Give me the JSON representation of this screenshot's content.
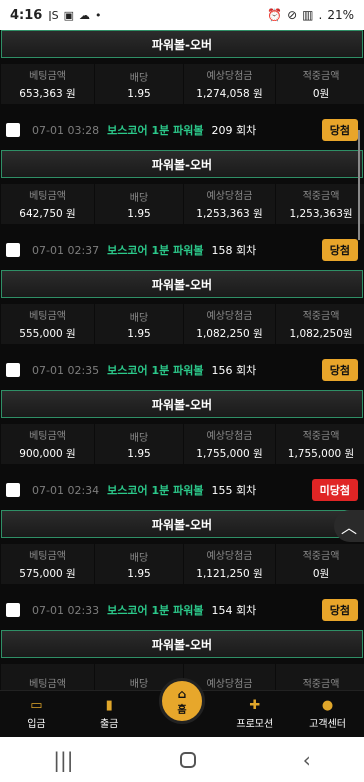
{
  "status": {
    "time": "4:16",
    "battery": "21%",
    "icons": [
      "ǀS",
      "▣",
      "☁",
      "•"
    ],
    "right_icons": [
      "⏰",
      "⊘",
      "▥",
      "."
    ]
  },
  "nav": {
    "deposit": "입금",
    "withdraw": "출금",
    "home": "홈",
    "promotion": "프로모션",
    "support": "고객센터"
  },
  "labels": {
    "bet": "베팅금액",
    "odds": "배당",
    "expected": "예상당첨금",
    "won": "적중금액"
  },
  "bets": [
    {
      "pick": "파워볼-오버",
      "amount": "653,363 원",
      "odds": "1.95",
      "expected": "1,274,058 원",
      "won": "0원"
    },
    {
      "date": "07-01 03:28",
      "game": "보스코어 1분 파워볼",
      "round": "209 회차",
      "result": "당첨",
      "pick": "파워볼-오버",
      "amount": "642,750 원",
      "odds": "1.95",
      "expected": "1,253,363 원",
      "won": "1,253,363원"
    },
    {
      "date": "07-01 02:37",
      "game": "보스코어 1분 파워볼",
      "round": "158 회차",
      "result": "당첨",
      "pick": "파워볼-오버",
      "amount": "555,000 원",
      "odds": "1.95",
      "expected": "1,082,250 원",
      "won": "1,082,250원"
    },
    {
      "date": "07-01 02:35",
      "game": "보스코어 1분 파워볼",
      "round": "156 회차",
      "result": "당첨",
      "pick": "파워볼-오버",
      "amount": "900,000 원",
      "odds": "1.95",
      "expected": "1,755,000 원",
      "won": "1,755,000 원"
    },
    {
      "date": "07-01 02:34",
      "game": "보스코어 1분 파워볼",
      "round": "155 회차",
      "result": "미당첨",
      "pick": "파워볼-오버",
      "amount": "575,000 원",
      "odds": "1.95",
      "expected": "1,121,250 원",
      "won": "0원"
    },
    {
      "date": "07-01 02:33",
      "game": "보스코어 1분 파워볼",
      "round": "154 회차",
      "result": "당첨",
      "pick": "파워볼-오버",
      "amount": "",
      "odds": "",
      "expected": "",
      "won": ""
    }
  ]
}
